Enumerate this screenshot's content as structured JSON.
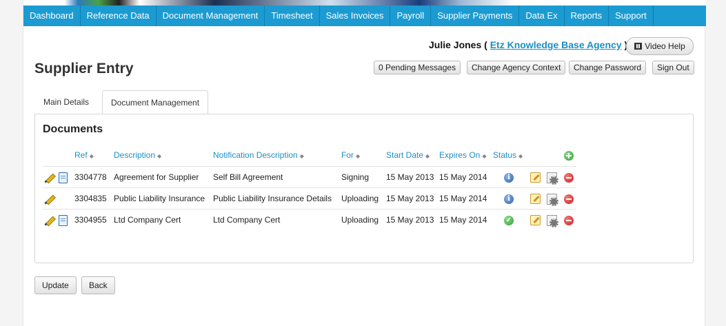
{
  "nav": {
    "items": [
      "Dashboard",
      "Reference Data",
      "Document Management",
      "Timesheet",
      "Sales Invoices",
      "Payroll",
      "Supplier Payments",
      "Data Ex",
      "Reports",
      "Support"
    ]
  },
  "user": {
    "name": "Julie Jones (",
    "agency": "Etz Knowledge Base Agency",
    "close_paren": ")"
  },
  "header_buttons": {
    "video_help": "Video Help",
    "pending_messages": "0 Pending Messages",
    "change_agency": "Change Agency Context",
    "change_password": "Change Password",
    "sign_out": "Sign Out"
  },
  "page_title": "Supplier Entry",
  "tabs": [
    "Main Details",
    "Document Management"
  ],
  "documents": {
    "title": "Documents",
    "columns": [
      "Ref",
      "Description",
      "Notification Description",
      "For",
      "Start Date",
      "Expires On",
      "Status"
    ],
    "rows": [
      {
        "ref": "3304778",
        "description": "Agreement for Supplier",
        "notification": "Self Bill Agreement",
        "for": "Signing",
        "start": "15 May 2013",
        "expires": "15 May 2014",
        "status": "info-icon",
        "has_doc": true
      },
      {
        "ref": "3304835",
        "description": "Public Liability Insurance",
        "notification": "Public Liability Insurance Details",
        "for": "Uploading",
        "start": "15 May 2013",
        "expires": "15 May 2014",
        "status": "info-icon",
        "has_doc": false
      },
      {
        "ref": "3304955",
        "description": "Ltd Company Cert",
        "notification": "Ltd Company Cert",
        "for": "Uploading",
        "start": "15 May 2013",
        "expires": "15 May 2014",
        "status": "check-icon",
        "has_doc": true
      }
    ]
  },
  "footer_buttons": {
    "update": "Update",
    "back": "Back"
  }
}
